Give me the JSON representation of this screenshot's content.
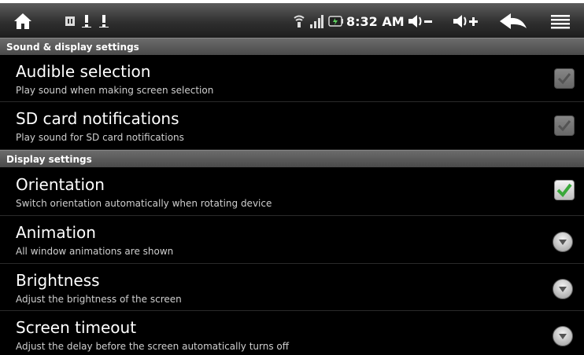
{
  "status_bar": {
    "time": "8:32 AM",
    "icons": [
      "home-icon",
      "usb-debug-icon",
      "warning-icon",
      "warning-icon",
      "wifi-icon",
      "signal-icon",
      "battery-icon",
      "volume-down-icon",
      "volume-up-icon",
      "back-icon",
      "menu-icon"
    ]
  },
  "sections": [
    {
      "header": "Sound & display settings",
      "items": [
        {
          "title": "Audible selection",
          "summary": "Play sound when making screen selection",
          "control": "checkbox",
          "checked": true,
          "enabled": false
        },
        {
          "title": "SD card notifications",
          "summary": "Play sound for SD card notifications",
          "control": "checkbox",
          "checked": true,
          "enabled": false
        }
      ]
    },
    {
      "header": "Display settings",
      "items": [
        {
          "title": "Orientation",
          "summary": "Switch orientation automatically when rotating device",
          "control": "checkbox",
          "checked": true,
          "enabled": true
        },
        {
          "title": "Animation",
          "summary": "All window animations are shown",
          "control": "dropdown"
        },
        {
          "title": "Brightness",
          "summary": "Adjust the brightness of the screen",
          "control": "dropdown"
        },
        {
          "title": "Screen timeout",
          "summary": "Adjust the delay before the screen automatically turns off",
          "control": "dropdown"
        }
      ]
    }
  ],
  "colors": {
    "check_active": "#3aa83a",
    "check_disabled": "#9a9a9a",
    "header_bg": "#5a5a5a"
  }
}
